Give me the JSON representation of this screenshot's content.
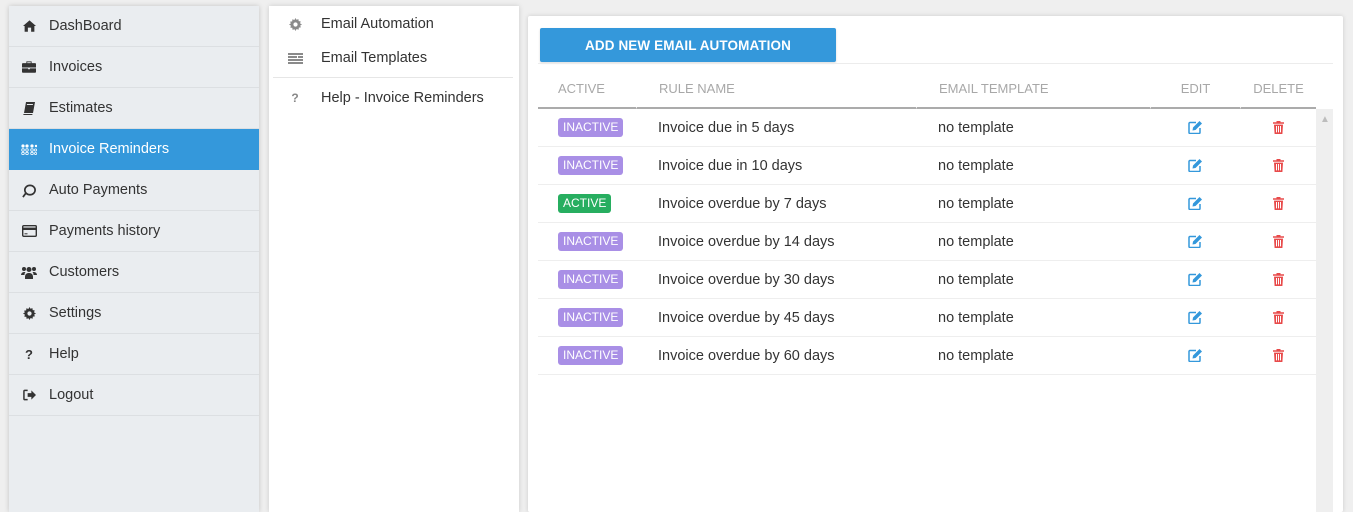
{
  "colors": {
    "accent": "#3498db",
    "inactive_badge": "#a98fe6",
    "active_badge": "#27ae60",
    "edit_icon": "#3498db",
    "delete_icon": "#e84a4a"
  },
  "sidebar": {
    "items": [
      {
        "label": "DashBoard",
        "icon": "home-icon",
        "active": false
      },
      {
        "label": "Invoices",
        "icon": "briefcase-icon",
        "active": false
      },
      {
        "label": "Estimates",
        "icon": "book-icon",
        "active": false
      },
      {
        "label": "Invoice Reminders",
        "icon": "grid-dots-icon",
        "active": true
      },
      {
        "label": "Auto Payments",
        "icon": "circle-sync-icon",
        "active": false
      },
      {
        "label": "Payments history",
        "icon": "credit-card-icon",
        "active": false
      },
      {
        "label": "Customers",
        "icon": "users-icon",
        "active": false
      },
      {
        "label": "Settings",
        "icon": "gear-icon",
        "active": false
      },
      {
        "label": "Help",
        "icon": "question-icon",
        "active": false
      },
      {
        "label": "Logout",
        "icon": "logout-icon",
        "active": false
      }
    ]
  },
  "submenu": {
    "items": [
      {
        "label": "Email Automation",
        "icon": "gear-icon"
      },
      {
        "label": "Email Templates",
        "icon": "list-icon"
      },
      {
        "label": "Help - Invoice Reminders",
        "icon": "question-icon"
      }
    ]
  },
  "main": {
    "add_button": "ADD NEW EMAIL AUTOMATION",
    "table": {
      "columns": [
        "ACTIVE",
        "RULE NAME",
        "EMAIL TEMPLATE",
        "EDIT",
        "DELETE"
      ],
      "rows": [
        {
          "status": "INACTIVE",
          "rule": "Invoice due in 5 days",
          "template": "no template"
        },
        {
          "status": "INACTIVE",
          "rule": "Invoice due in 10 days",
          "template": "no template"
        },
        {
          "status": "ACTIVE",
          "rule": "Invoice overdue by 7 days",
          "template": "no template"
        },
        {
          "status": "INACTIVE",
          "rule": "Invoice overdue by 14 days",
          "template": "no template"
        },
        {
          "status": "INACTIVE",
          "rule": "Invoice overdue by 30 days",
          "template": "no template"
        },
        {
          "status": "INACTIVE",
          "rule": "Invoice overdue by 45 days",
          "template": "no template"
        },
        {
          "status": "INACTIVE",
          "rule": "Invoice overdue by 60 days",
          "template": "no template"
        }
      ]
    }
  }
}
